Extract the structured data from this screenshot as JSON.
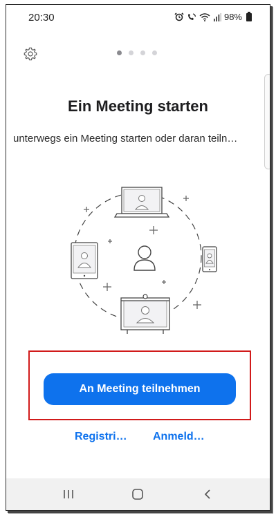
{
  "status_bar": {
    "time": "20:30",
    "icons": [
      "alarm-icon",
      "wifi-call-icon",
      "wifi-icon",
      "signal-icon"
    ],
    "battery": "98%"
  },
  "header": {
    "settings_icon": "gear-icon",
    "pager": {
      "pages": 4,
      "active_index": 0
    }
  },
  "main": {
    "title": "Ein Meeting starten",
    "subtitle": "unterwegs ein Meeting starten oder daran teiln…",
    "illustration_icons": [
      "laptop-icon",
      "tablet-icon",
      "phone-icon",
      "person-icon",
      "conference-screen-icon"
    ]
  },
  "actions": {
    "join_label": "An Meeting teilnehmen",
    "register_label": "Registri…",
    "signin_label": "Anmeld…"
  },
  "nav_bar": {
    "recent_icon": "recent-apps-icon",
    "home_icon": "home-icon",
    "back_icon": "back-icon"
  },
  "colors": {
    "accent": "#0e72ed",
    "highlight": "#d11a1a",
    "nav_bg": "#f1f1f1"
  }
}
